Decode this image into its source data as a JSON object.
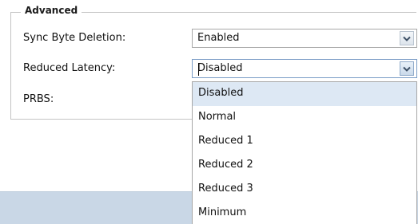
{
  "fieldset": {
    "legend": "Advanced"
  },
  "fields": [
    {
      "label": "Sync Byte Deletion:",
      "value": "Enabled"
    },
    {
      "label": "Reduced Latency:",
      "value": "Disabled"
    },
    {
      "label": "PRBS:"
    }
  ],
  "dropdown": {
    "options": [
      "Disabled",
      "Normal",
      "Reduced 1",
      "Reduced 2",
      "Reduced 3",
      "Minimum"
    ],
    "selected": "Disabled"
  },
  "icons": {
    "select_arrow": "chevron-down-icon"
  },
  "colors": {
    "selected_option_bg": "#dde8f4",
    "footer_bar": "#c9d7e6",
    "border": "#a7a7a7"
  }
}
